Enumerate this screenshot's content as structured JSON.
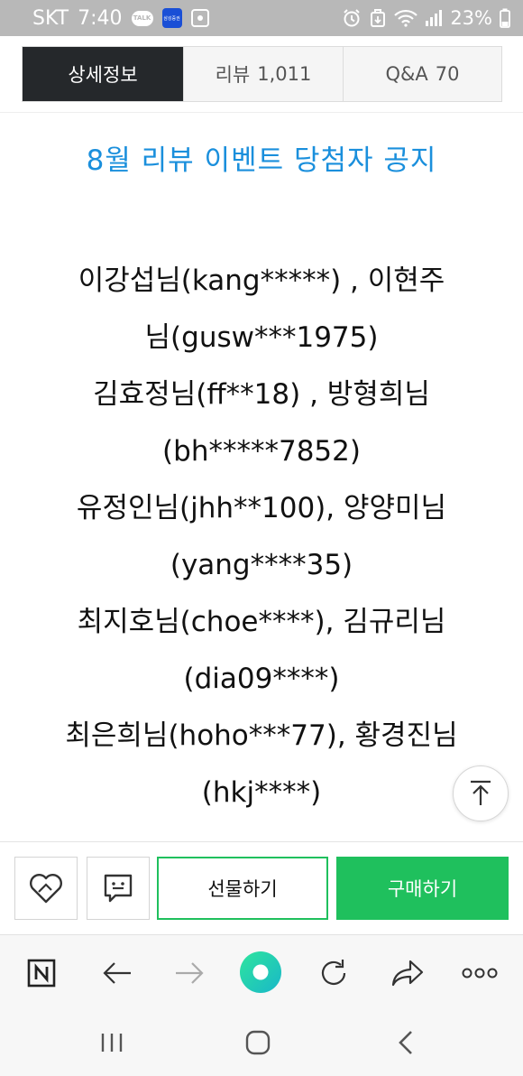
{
  "status_bar": {
    "carrier": "SKT",
    "time": "7:40",
    "talk_badge": "TALK",
    "app_badge": "삼성증권",
    "battery": "23%"
  },
  "tabs": [
    {
      "label": "상세정보",
      "count": "",
      "active": true
    },
    {
      "label": "리뷰",
      "count": "1,011",
      "active": false
    },
    {
      "label": "Q&A",
      "count": "70",
      "active": false
    }
  ],
  "notice": {
    "title": "8월 리뷰 이벤트 당첨자 공지",
    "title_color": "#1a8fdc",
    "lines": [
      "이강섭님(kang*****) ,  이현주",
      "님(gusw***1975)",
      "김효정님(ff**18) ,  방형희님",
      "(bh*****7852)",
      "유정인님(jhh**100), 양양미님",
      "(yang****35)",
      "최지호님(choe****), 김규리님",
      "(dia09****)",
      "최은희님(hoho***77), 황경진님",
      "(hkj****)"
    ]
  },
  "purchase_bar": {
    "gift_label": "선물하기",
    "buy_label": "구매하기",
    "accent_color": "#1fc05d"
  },
  "icons": {
    "status": [
      "kakaotalk-icon",
      "samsung-securities-icon",
      "gallery-icon",
      "alarm-icon",
      "recycle-icon",
      "wifi-icon",
      "signal-icon",
      "battery-icon"
    ],
    "purchase": [
      "heart-wish-icon",
      "talk-bubble-icon"
    ],
    "toolbar": [
      "naver-n-icon",
      "back-arrow-icon",
      "forward-arrow-icon",
      "green-dot-icon",
      "refresh-icon",
      "share-icon",
      "more-icon"
    ],
    "nav": [
      "recent-apps-icon",
      "home-icon",
      "back-icon"
    ]
  }
}
